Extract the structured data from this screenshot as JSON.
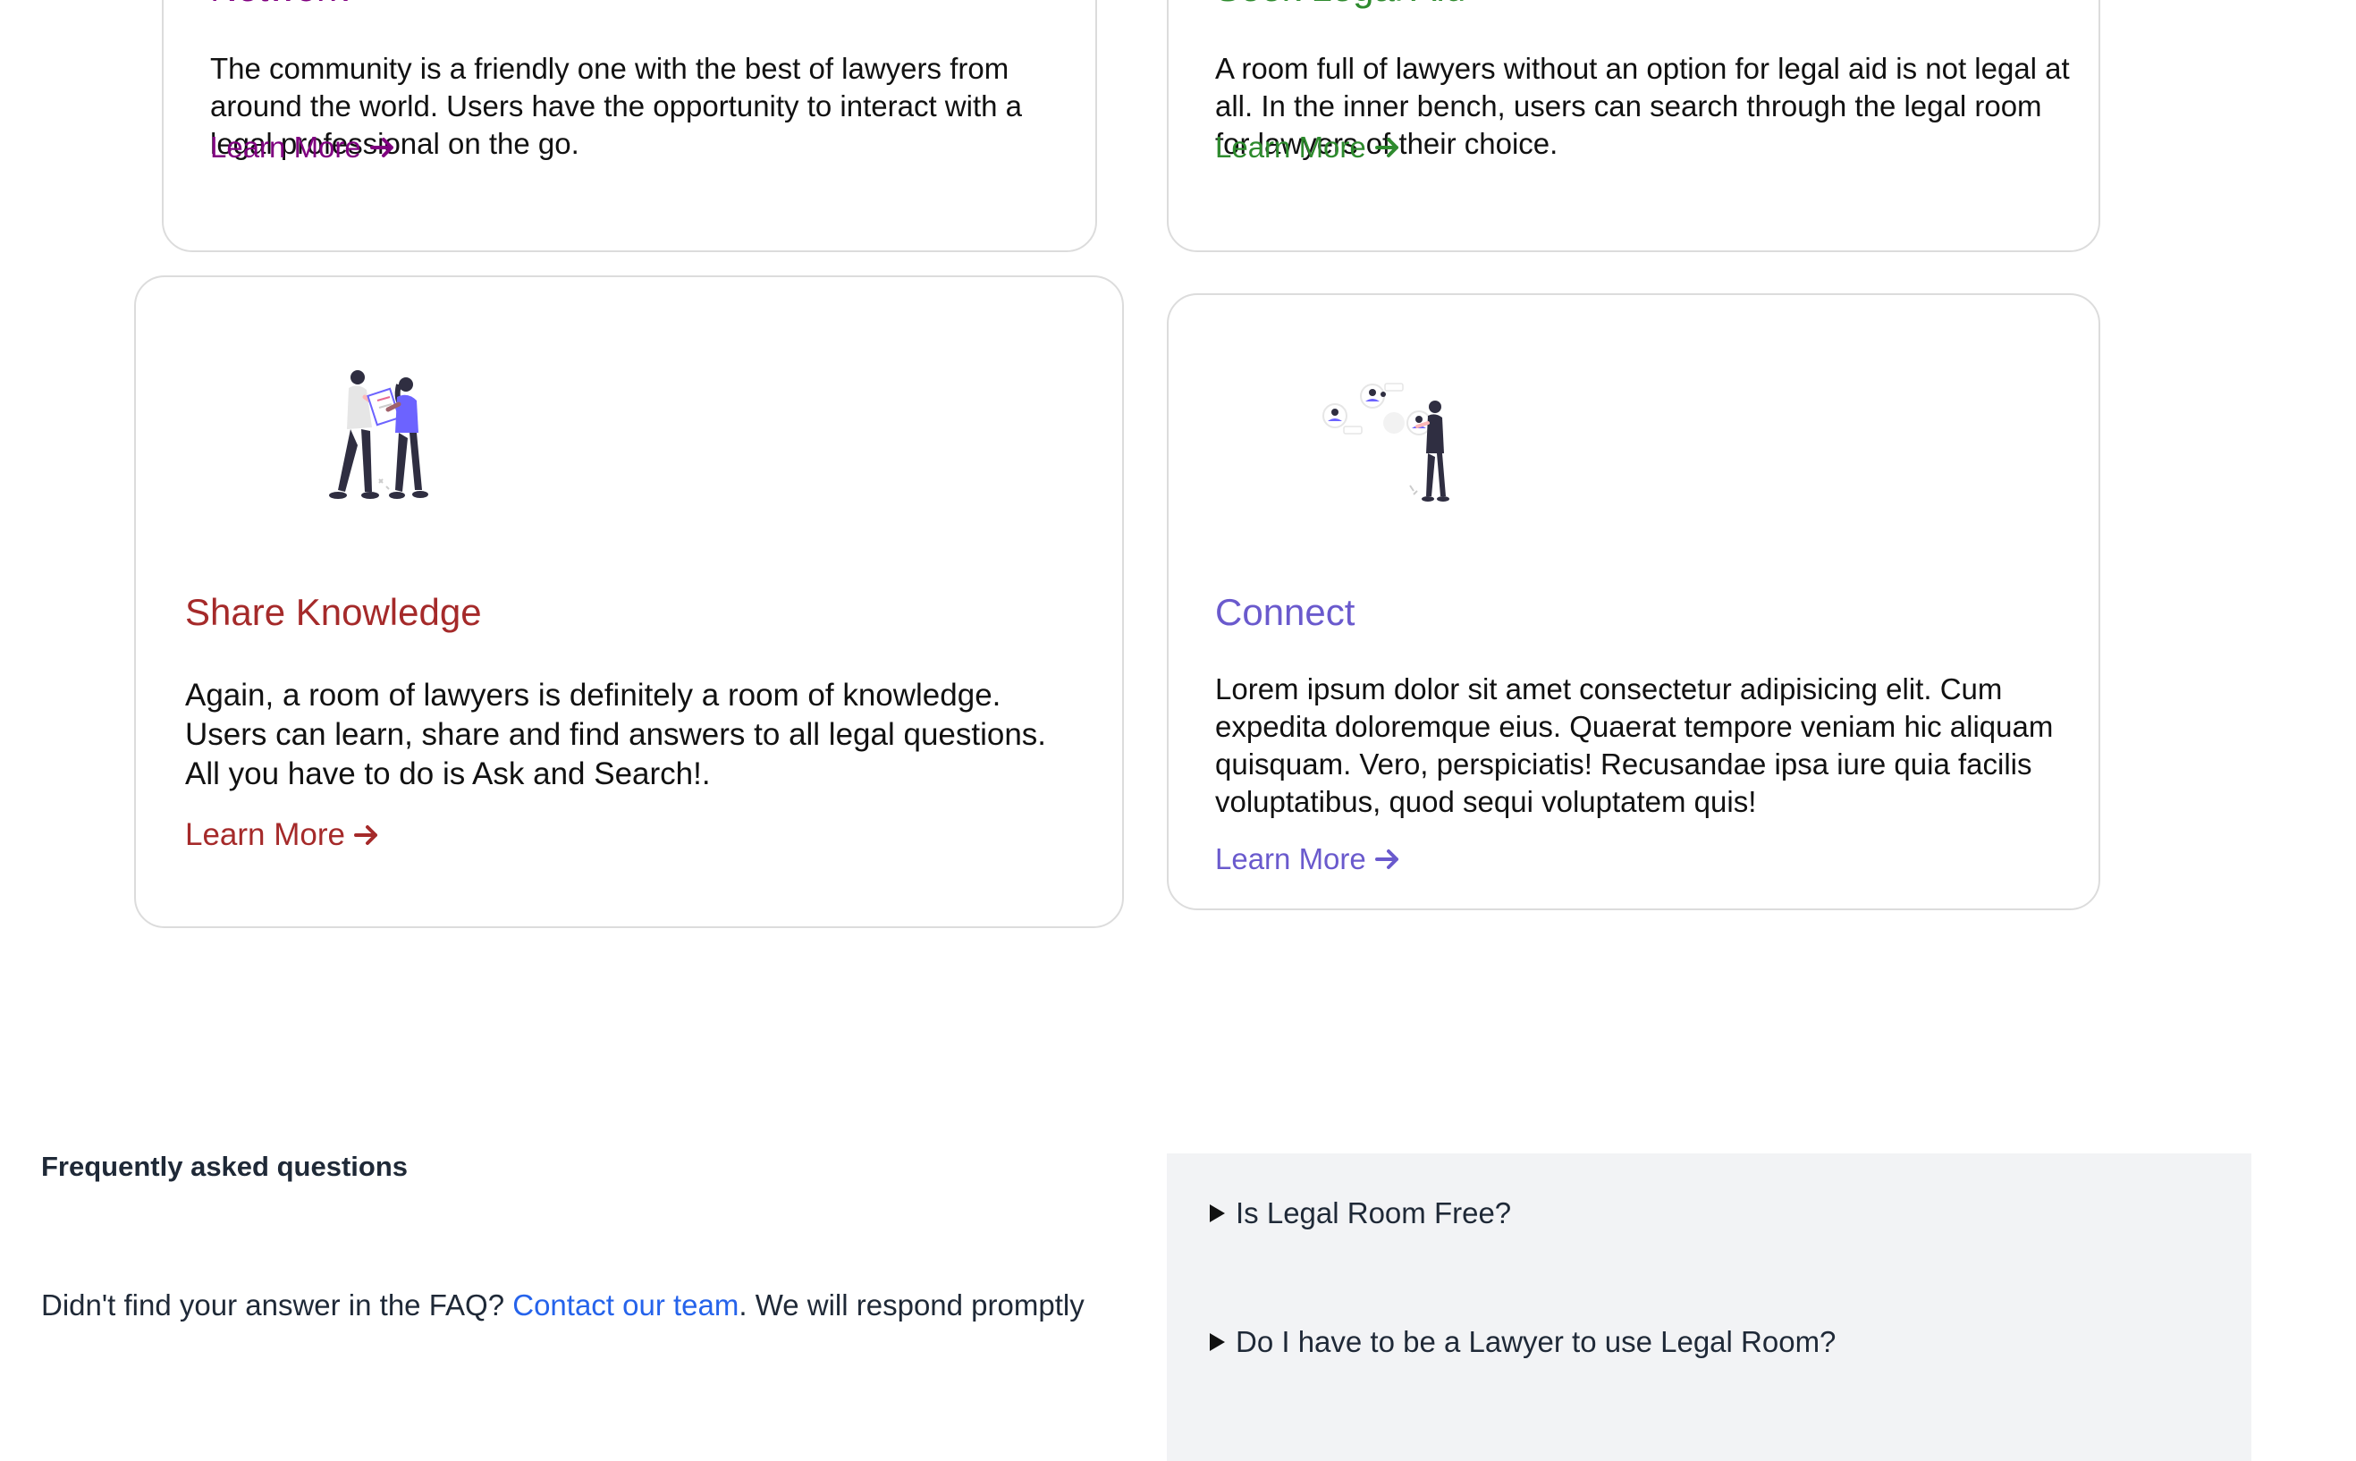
{
  "cards": {
    "network": {
      "title": "Network",
      "desc": "The community is a friendly one with the best of lawyers from around the world. Users have the opportunity to interact with a legal professional on the go.",
      "link": "Learn More",
      "color": "#800080"
    },
    "legal_aid": {
      "title": "Seek Legal Aid",
      "desc": "A room full of lawyers without an option for legal aid is not legal at all. In the inner bench, users can search through the legal room for lawyers of their choice.",
      "link": "Learn More",
      "color": "#2e8b2e"
    },
    "share": {
      "title": "Share Knowledge",
      "desc": "Again, a room of lawyers is definitely a room of knowledge. Users can learn, share and find answers to all legal questions. All you have to do is Ask and Search!.",
      "link": "Learn More",
      "color": "#a52a2a",
      "illustration": "two-people-sharing-document-illustration"
    },
    "connect": {
      "title": "Connect",
      "desc": "Lorem ipsum dolor sit amet consectetur adipisicing elit. Cum expedita doloremque eius. Quaerat tempore veniam hic aliquam quisquam. Vero, perspiciatis! Recusandae ipsa iure quia facilis voluptatibus, quod sequi voluptatem quis!",
      "link": "Learn More",
      "color": "#6a5acd",
      "illustration": "person-connecting-profiles-illustration"
    }
  },
  "faq": {
    "heading": "Frequently asked questions",
    "note_prefix": "Didn't find your answer in the FAQ? ",
    "note_link": "Contact our team",
    "note_suffix": ". We will respond promptly",
    "items": [
      "Is Legal Room Free?",
      "Do I have to be a Lawyer to use Legal Room?"
    ]
  }
}
